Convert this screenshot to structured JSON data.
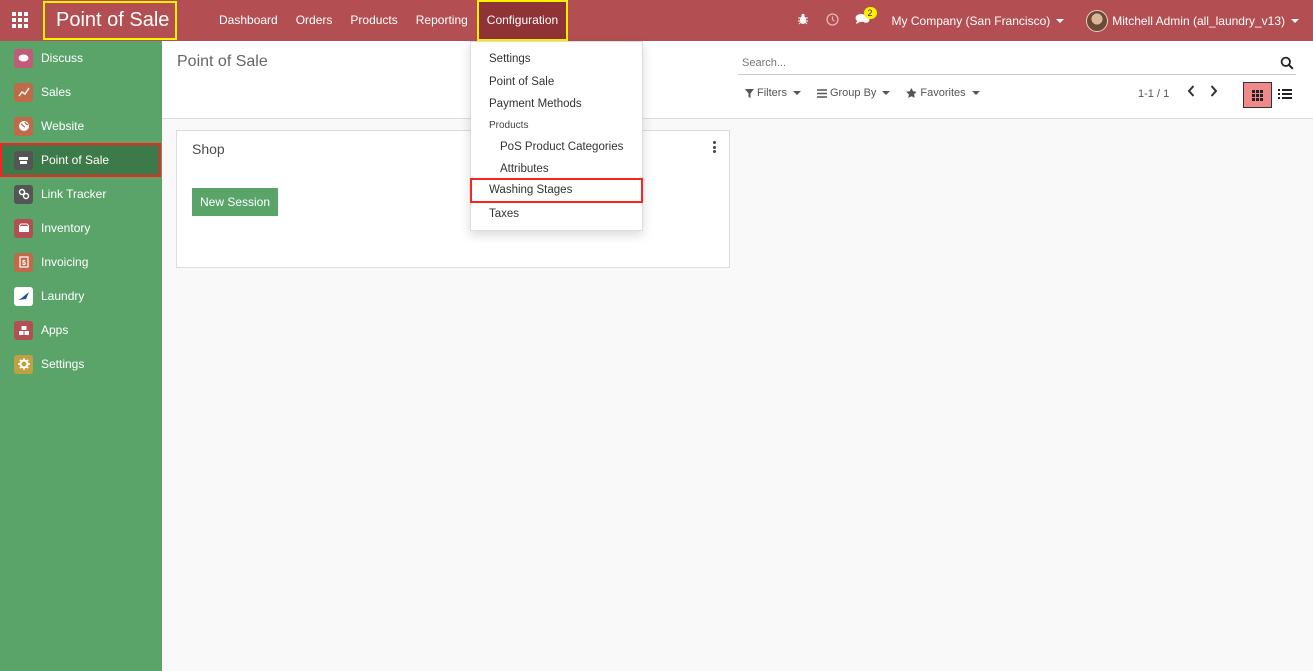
{
  "navbar": {
    "app_title": "Point of Sale",
    "menu": [
      "Dashboard",
      "Orders",
      "Products",
      "Reporting",
      "Configuration"
    ],
    "active_menu": "Configuration",
    "message_count": "2",
    "company": "My Company (San Francisco)",
    "user": "Mitchell Admin (all_laundry_v13)"
  },
  "sidebar": {
    "items": [
      {
        "label": "Discuss",
        "icon": "discuss-icon",
        "color": "#c05b7a"
      },
      {
        "label": "Sales",
        "icon": "sales-chart-icon",
        "color": "#c06a4a"
      },
      {
        "label": "Website",
        "icon": "globe-icon",
        "color": "#c06a4a"
      },
      {
        "label": "Point of Sale",
        "icon": "store-icon",
        "color": "#555555"
      },
      {
        "label": "Link Tracker",
        "icon": "link-icon",
        "color": "#555555"
      },
      {
        "label": "Inventory",
        "icon": "box-icon",
        "color": "#b34f52"
      },
      {
        "label": "Invoicing",
        "icon": "invoice-icon",
        "color": "#c06a4a"
      },
      {
        "label": "Laundry",
        "icon": "laundry-icon",
        "color": "#ffffff"
      },
      {
        "label": "Apps",
        "icon": "apps-cubes-icon",
        "color": "#b34f52"
      },
      {
        "label": "Settings",
        "icon": "gear-icon",
        "color": "#c0a040"
      }
    ],
    "active_item": "Point of Sale"
  },
  "control_panel": {
    "title": "Point of Sale",
    "search_placeholder": "Search...",
    "filters_label": "Filters",
    "group_by_label": "Group By",
    "favorites_label": "Favorites",
    "pager": "1-1 / 1"
  },
  "kanban": {
    "card_title": "Shop",
    "button_label": "New Session"
  },
  "dropdown": {
    "settings": "Settings",
    "point_of_sale": "Point of Sale",
    "payment_methods": "Payment Methods",
    "products_header": "Products",
    "pos_product_categories": "PoS Product Categories",
    "attributes": "Attributes",
    "washing_stages": "Washing Stages",
    "taxes": "Taxes"
  },
  "colors": {
    "navbar": "#b34f52",
    "sidebar": "#5aa469",
    "highlight_yellow": "#fff200",
    "highlight_red": "#ff2020"
  }
}
